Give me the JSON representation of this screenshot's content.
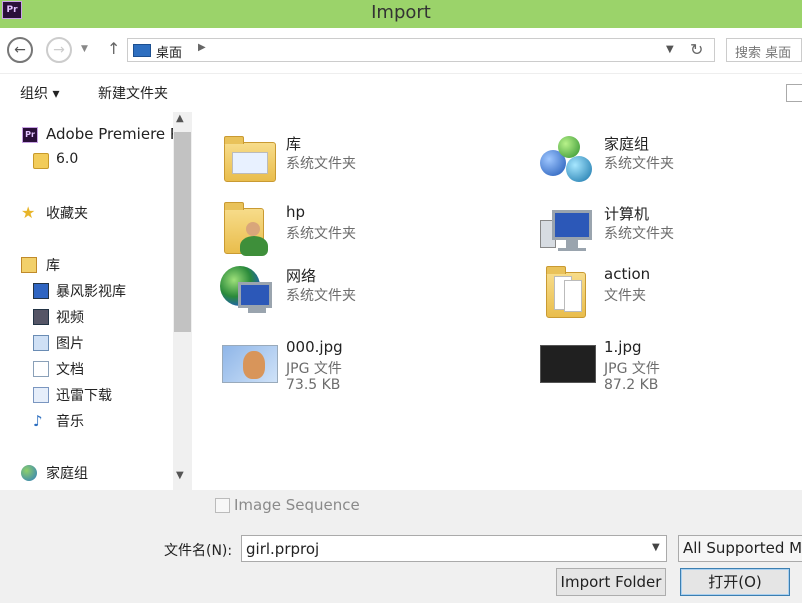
{
  "window": {
    "title": "Import",
    "app_icon_text": "Pr"
  },
  "address_bar": {
    "path": "桌面",
    "search_placeholder": "搜索 桌面"
  },
  "toolbar": {
    "organize_label": "组织 ▾",
    "new_folder_label": "新建文件夹"
  },
  "navigation": {
    "items": [
      {
        "label": "Adobe Premiere P",
        "icon": "premiere-icon"
      },
      {
        "label": "6.0",
        "icon": "folder-icon"
      },
      {
        "label": "收藏夹",
        "icon": "star-icon"
      },
      {
        "label": "库",
        "icon": "library-icon"
      },
      {
        "label": "暴风影视库",
        "icon": "media-library-icon"
      },
      {
        "label": "视频",
        "icon": "video-icon"
      },
      {
        "label": "图片",
        "icon": "pictures-icon"
      },
      {
        "label": "文档",
        "icon": "documents-icon"
      },
      {
        "label": "迅雷下载",
        "icon": "download-icon"
      },
      {
        "label": "音乐",
        "icon": "music-icon"
      },
      {
        "label": "家庭组",
        "icon": "homegroup-icon"
      }
    ]
  },
  "files": [
    {
      "name": "库",
      "type": "系统文件夹",
      "size": "",
      "icon": "libraries-folder-icon"
    },
    {
      "name": "家庭组",
      "type": "系统文件夹",
      "size": "",
      "icon": "homegroup-icon"
    },
    {
      "name": "hp",
      "type": "系统文件夹",
      "size": "",
      "icon": "user-folder-icon"
    },
    {
      "name": "计算机",
      "type": "系统文件夹",
      "size": "",
      "icon": "computer-icon"
    },
    {
      "name": "网络",
      "type": "系统文件夹",
      "size": "",
      "icon": "network-icon"
    },
    {
      "name": "action",
      "type": "文件夹",
      "size": "",
      "icon": "folder-icon"
    },
    {
      "name": "000.jpg",
      "type": "JPG 文件",
      "size": "73.5 KB",
      "icon": "image-thumbnail"
    },
    {
      "name": "1.jpg",
      "type": "JPG 文件",
      "size": "87.2 KB",
      "icon": "image-thumbnail"
    }
  ],
  "bottom": {
    "image_sequence_label": "Image Sequence",
    "image_sequence_checked": false,
    "filename_label": "文件名(N):",
    "filename_value": "girl.prproj",
    "file_type_selected": "All Supported M",
    "import_folder_label": "Import Folder",
    "open_label": "打开(O)"
  }
}
